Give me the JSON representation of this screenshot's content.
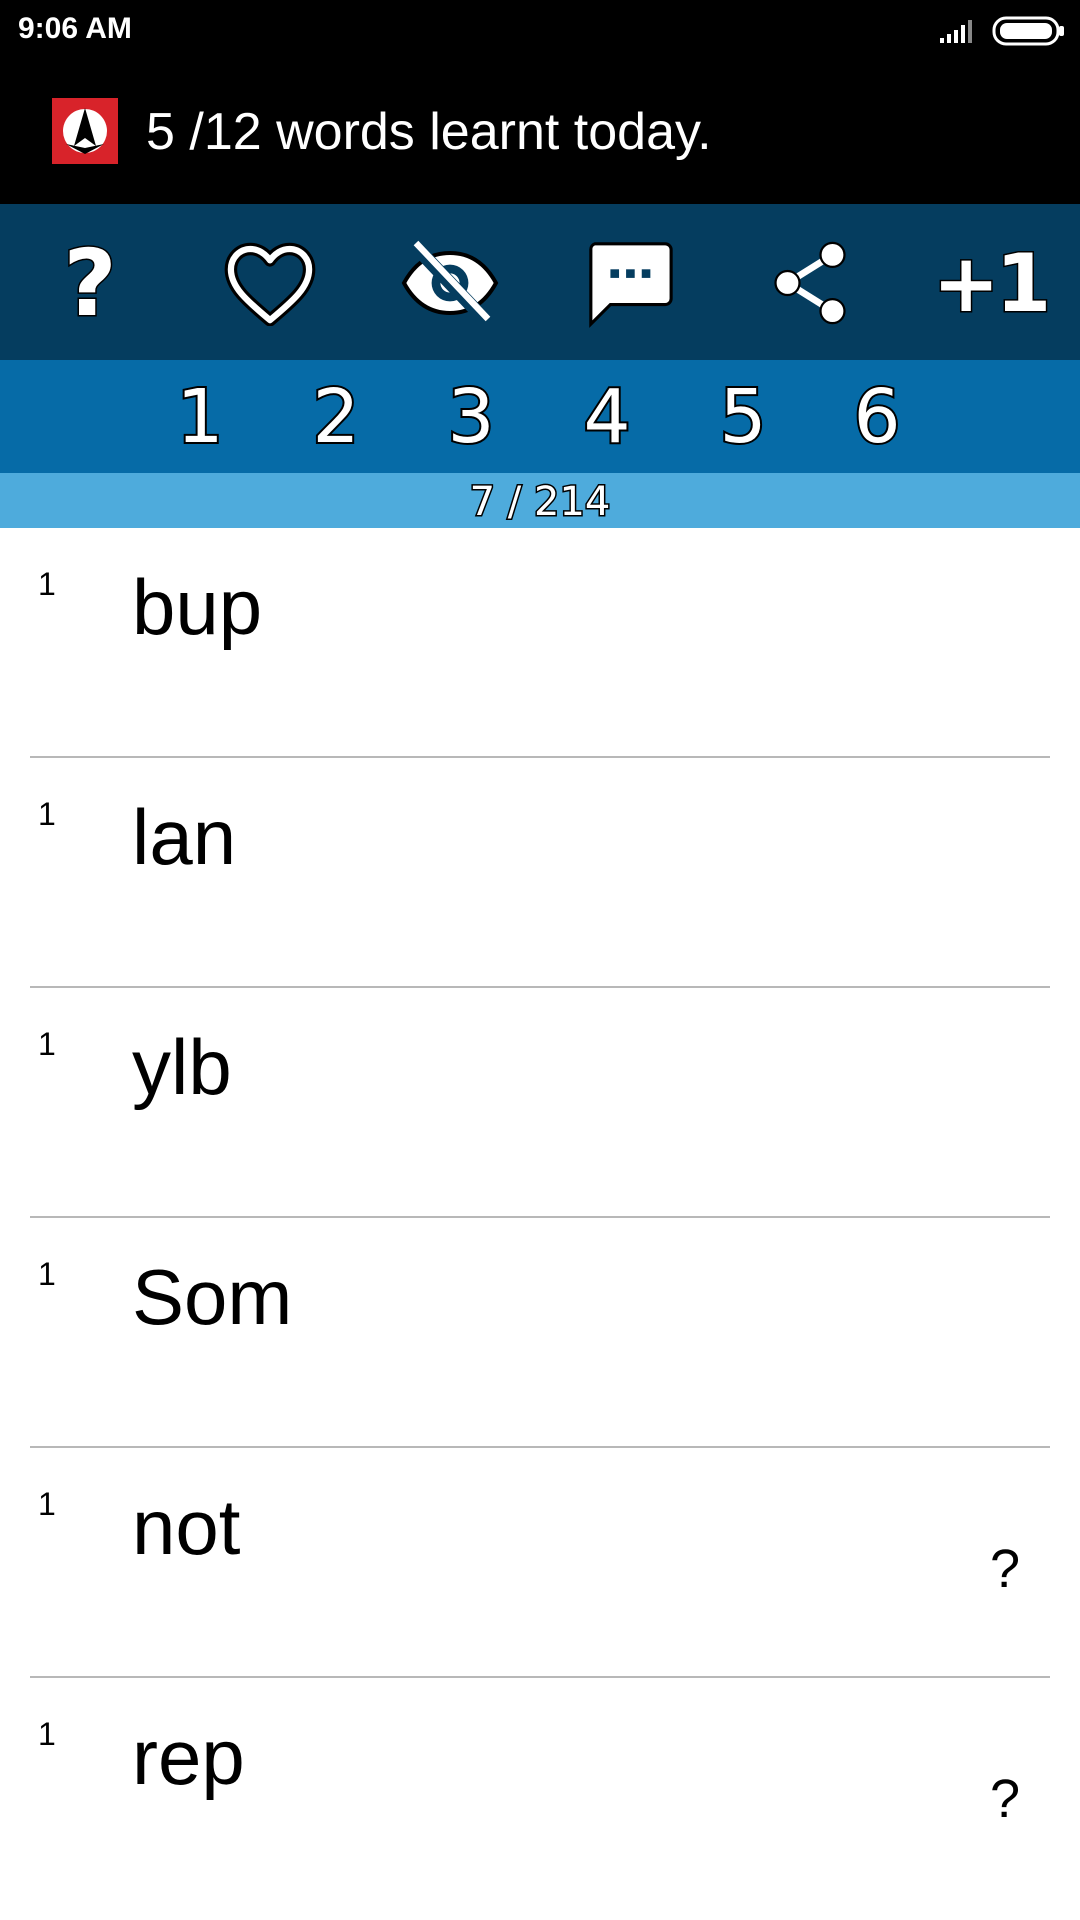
{
  "status_bar": {
    "time": "9:06 AM",
    "icons": [
      "signal-icon",
      "battery-icon"
    ]
  },
  "app_bar": {
    "logo": "app-logo-icon",
    "title": "5 /12 words learnt today."
  },
  "toolbar": {
    "help": "?",
    "favorite_icon": "heart-icon",
    "hide_icon": "eye-off-icon",
    "comment_icon": "comment-icon",
    "share_icon": "share-icon",
    "plus_one": "+1"
  },
  "levels": [
    "1",
    "2",
    "3",
    "4",
    "5",
    "6"
  ],
  "progress": "7 / 214",
  "words": [
    {
      "count": "1",
      "text": "bup",
      "hint": ""
    },
    {
      "count": "1",
      "text": "lan",
      "hint": ""
    },
    {
      "count": "1",
      "text": "ylb",
      "hint": ""
    },
    {
      "count": "1",
      "text": "Som",
      "hint": ""
    },
    {
      "count": "1",
      "text": "not",
      "hint": "?"
    },
    {
      "count": "1",
      "text": "rep",
      "hint": "?"
    }
  ],
  "colors": {
    "app_bar": "#000000",
    "toolbar": "#053d5f",
    "level_bar": "#066ba7",
    "progress_bar": "#4eabdc",
    "logo_red": "#d8232a"
  }
}
